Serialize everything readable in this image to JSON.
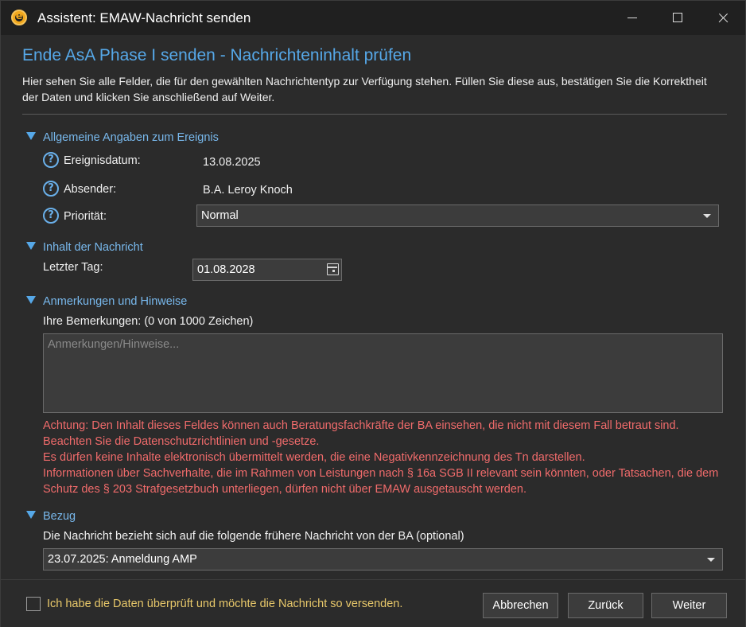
{
  "window": {
    "title": "Assistent: EMAW-Nachricht senden",
    "app_icon_letter": "e"
  },
  "page": {
    "heading": "Ende AsA Phase I senden - Nachrichteninhalt prüfen",
    "intro": "Hier sehen Sie alle Felder, die für den gewählten Nachrichtentyp zur Verfügung stehen. Füllen Sie diese aus, bestätigen Sie die Korrektheit der Daten und klicken Sie anschließend auf Weiter."
  },
  "general": {
    "header": "Allgemeine Angaben zum Ereignis",
    "help_glyph": "?",
    "date_label": "Ereignisdatum:",
    "date_value": "13.08.2025",
    "sender_label": "Absender:",
    "sender_value": "B.A. Leroy Knoch",
    "priority_label": "Priorität:",
    "priority_value": "Normal"
  },
  "content": {
    "header": "Inhalt der Nachricht",
    "last_day_label": "Letzter Tag:",
    "last_day_value": "01.08.2028"
  },
  "remarks": {
    "header": "Anmerkungen und Hinweise",
    "label": "Ihre Bemerkungen: (0 von 1000 Zeichen)",
    "placeholder": "Anmerkungen/Hinweise...",
    "warning_lines": [
      "Achtung: Den Inhalt dieses Feldes können auch Beratungsfachkräfte der BA einsehen, die nicht mit diesem Fall betraut sind.",
      "Beachten Sie die Datenschutzrichtlinien und -gesetze.",
      "Es dürfen keine Inhalte elektronisch übermittelt werden, die eine Negativkennzeichnung des Tn darstellen.",
      "Informationen über Sachverhalte, die im Rahmen von Leistungen nach § 16a SGB II relevant sein könnten, oder Tatsachen, die dem Schutz des § 203 Strafgesetzbuch unterliegen, dürfen nicht über EMAW ausgetauscht werden."
    ]
  },
  "reference": {
    "header": "Bezug",
    "label": "Die Nachricht bezieht sich auf die folgende frühere Nachricht von der BA (optional)",
    "selected": "23.07.2025: Anmeldung AMP"
  },
  "footer": {
    "confirm_label": "Ich habe die Daten überprüft und möchte die Nachricht so versenden.",
    "confirm_checked": false,
    "cancel_label": "Abbrechen",
    "back_label": "Zurück",
    "next_label": "Weiter"
  },
  "colors": {
    "accent": "#56a8e8",
    "warning": "#f06b6b",
    "confirm_text": "#e8c86a"
  }
}
